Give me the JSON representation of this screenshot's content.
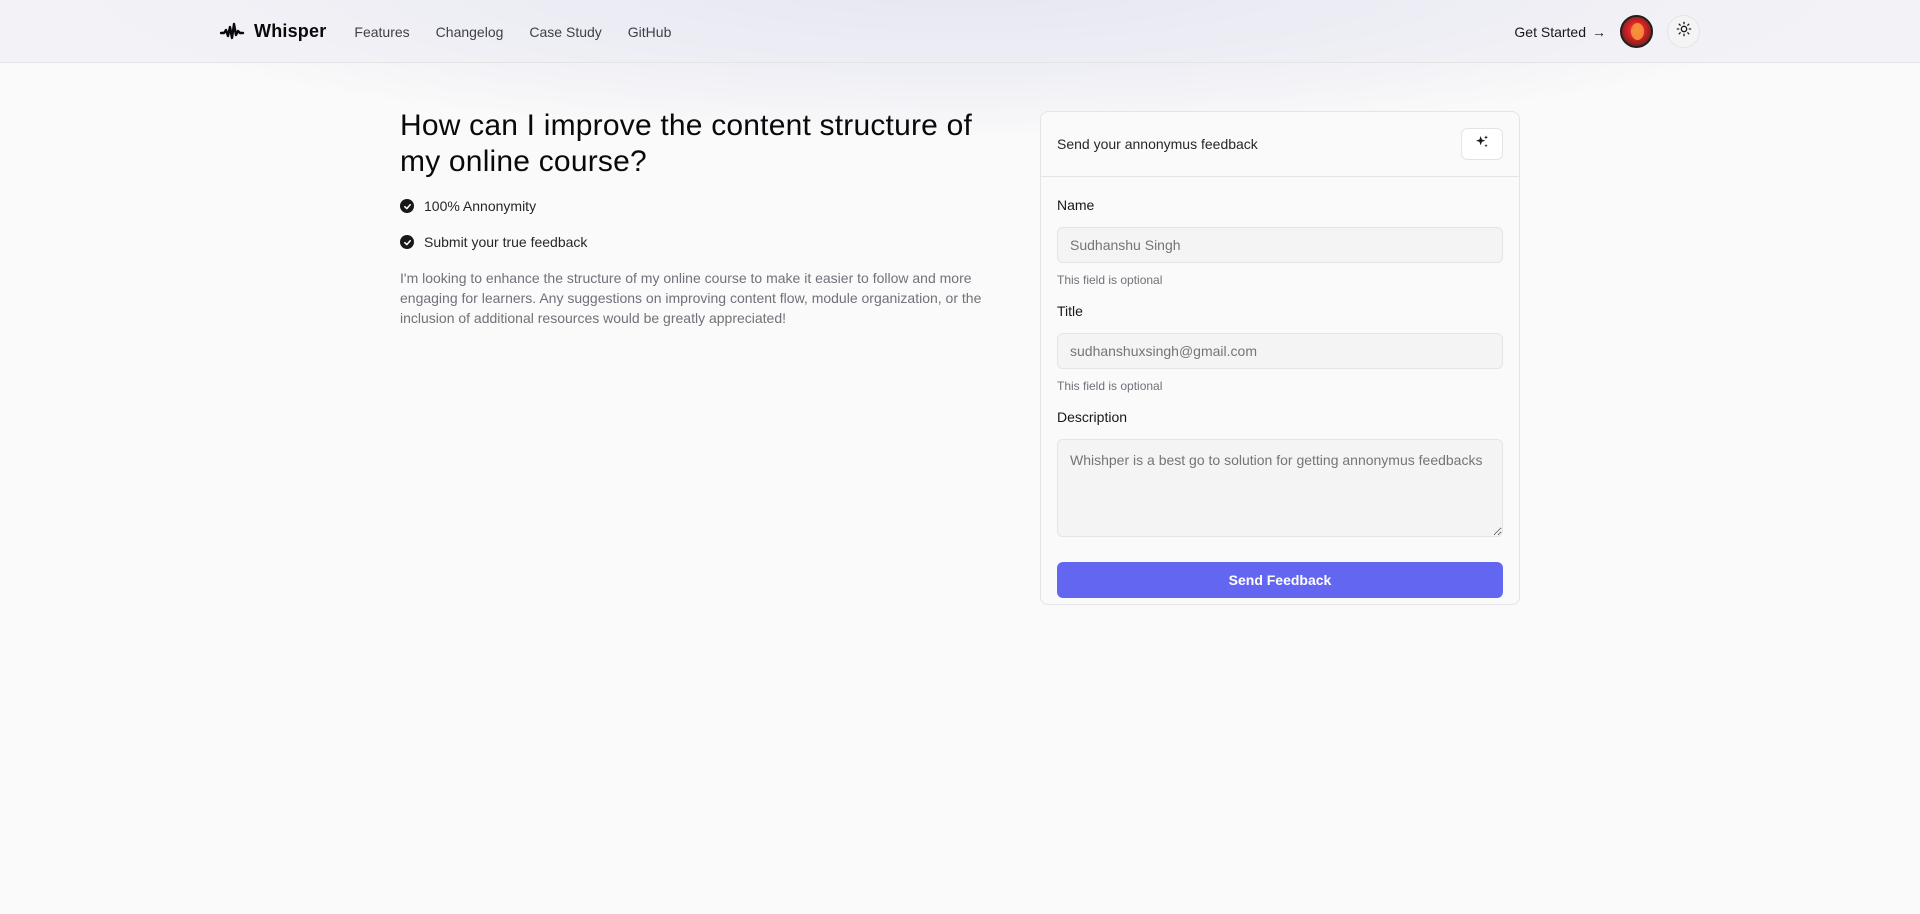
{
  "nav": {
    "brand": "Whisper",
    "links": [
      "Features",
      "Changelog",
      "Case Study",
      "GitHub"
    ],
    "cta": "Get Started",
    "cta_arrow": "→"
  },
  "main": {
    "question": "How can I improve the content structure of my online course?",
    "checks": [
      "100% Annonymity",
      "Submit your true feedback"
    ],
    "description": "I'm looking to enhance the structure of my online course to make it easier to follow and more engaging for learners. Any suggestions on improving content flow, module organization, or the inclusion of additional resources would be greatly appreciated!"
  },
  "form": {
    "header": "Send your annonymus feedback",
    "name_label": "Name",
    "name_placeholder": "Sudhanshu Singh",
    "name_hint": "This field is optional",
    "title_label": "Title",
    "title_placeholder": "sudhanshuxsingh@gmail.com",
    "title_hint": "This field is optional",
    "description_label": "Description",
    "description_placeholder": "Whishper is a best go to solution for getting annonymus feedbacks",
    "submit": "Send Feedback"
  },
  "colors": {
    "accent": "#6366f1",
    "text": "#18181b",
    "muted": "#71717a",
    "border": "#e4e4e7"
  },
  "icons": {
    "brand": "soundwave-icon",
    "cta": "arrow-right-icon",
    "theme": "sun-icon",
    "ai": "sparkles-icon",
    "check": "check-circle-icon"
  }
}
